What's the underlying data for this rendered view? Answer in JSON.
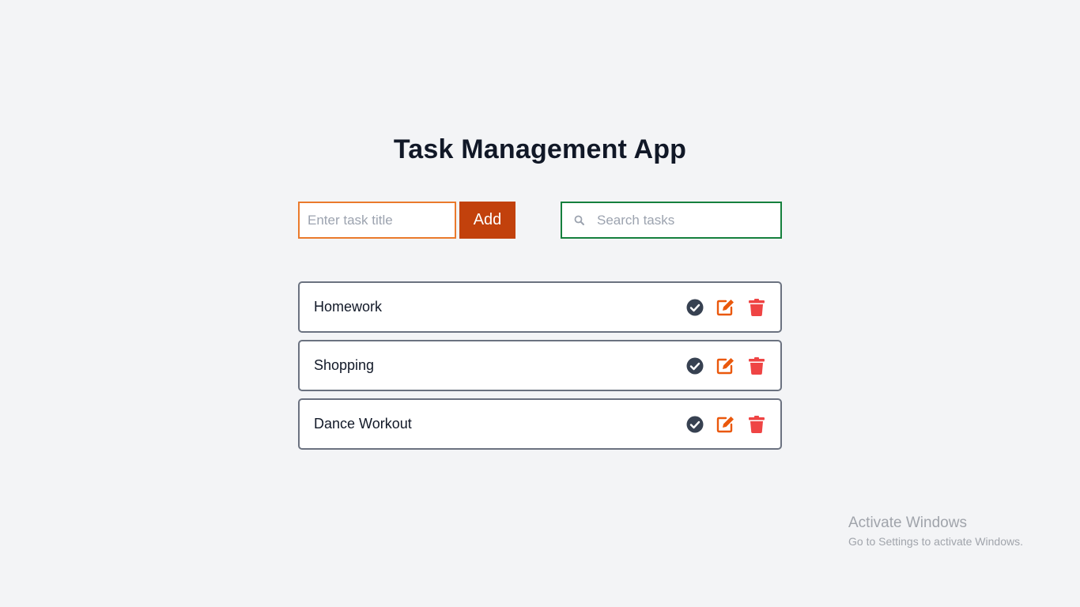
{
  "app": {
    "title": "Task Management App"
  },
  "new_task": {
    "placeholder": "Enter task title",
    "value": "",
    "add_label": "Add"
  },
  "search": {
    "placeholder": "Search tasks",
    "value": "",
    "icon": "search-icon"
  },
  "colors": {
    "accent_orange": "#c2410c",
    "input_border": "#ea7a2c",
    "search_border": "#15803d",
    "check_icon": "#374151",
    "edit_icon": "#ea580c",
    "delete_icon": "#ef4444"
  },
  "tasks": [
    {
      "title": "Homework",
      "actions": [
        "check-circle-icon",
        "edit-icon",
        "trash-icon"
      ]
    },
    {
      "title": "Shopping",
      "actions": [
        "check-circle-icon",
        "edit-icon",
        "trash-icon"
      ]
    },
    {
      "title": "Dance Workout",
      "actions": [
        "check-circle-icon",
        "edit-icon",
        "trash-icon"
      ]
    }
  ],
  "watermark": {
    "title": "Activate Windows",
    "subtitle": "Go to Settings to activate Windows."
  }
}
